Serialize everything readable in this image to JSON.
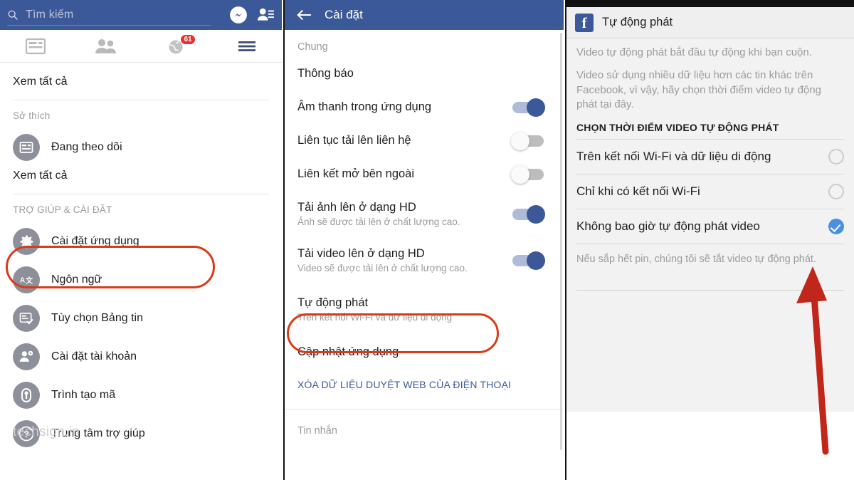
{
  "left_panel": {
    "search": {
      "placeholder": "Tìm kiếm",
      "icon": "search-icon"
    },
    "topbar_icons": [
      {
        "name": "messenger-icon"
      },
      {
        "name": "friend-requests-icon"
      }
    ],
    "tabs": [
      {
        "name": "news-feed-icon",
        "badge": ""
      },
      {
        "name": "friends-icon",
        "badge": ""
      },
      {
        "name": "notifications-globe-icon",
        "badge": "61"
      },
      {
        "name": "menu-hamburger-icon",
        "badge": ""
      }
    ],
    "see_all_top": "Xem tất cả",
    "section_interests": "Sở thích",
    "following_item": {
      "label": "Đang theo dõi",
      "icon": "feed-icon"
    },
    "see_all_bottom": "Xem tất cả",
    "section_help": "TRỢ GIÚP & CÀI ĐẶT",
    "items": [
      {
        "label": "Cài đặt ứng dụng",
        "icon": "gear-icon",
        "highlighted": true
      },
      {
        "label": "Ngôn ngữ",
        "icon": "translate-icon",
        "highlighted": false
      },
      {
        "label": "Tùy chọn Bảng tin",
        "icon": "feed-preferences-icon",
        "highlighted": false
      },
      {
        "label": "Cài đặt tài khoản",
        "icon": "account-settings-icon",
        "highlighted": false
      },
      {
        "label": "Trình tạo mã",
        "icon": "lock-icon",
        "highlighted": false
      },
      {
        "label": "Trung tâm trợ giúp",
        "icon": "question-mark-icon",
        "highlighted": false
      }
    ],
    "watermark": "techsign.in"
  },
  "mid_panel": {
    "back_icon": "back-arrow-icon",
    "title": "Cài đặt",
    "section_general": "Chung",
    "rows": [
      {
        "label": "Thông báo",
        "sub": "",
        "toggle": null
      },
      {
        "label": "Âm thanh trong ứng dụng",
        "sub": "",
        "toggle": "on"
      },
      {
        "label": "Liên tục tải lên liên hệ",
        "sub": "",
        "toggle": "off"
      },
      {
        "label": "Liên kết mở bên ngoài",
        "sub": "",
        "toggle": "off"
      },
      {
        "label": "Tải ảnh lên ở dạng HD",
        "sub": "Ảnh sẽ được tải lên ở chất lượng cao.",
        "toggle": "on"
      },
      {
        "label": "Tải video lên ở dạng HD",
        "sub": "Video sẽ được tải lên ở chất lượng cao.",
        "toggle": "on"
      },
      {
        "label": "Tự động phát",
        "sub": "Trên kết nối Wi-Fi và dữ liệu di động",
        "toggle": null,
        "highlighted": true
      },
      {
        "label": "Cập nhật ứng dụng",
        "sub": "",
        "toggle": null
      }
    ],
    "clear_link": "XÓA DỮ LIỆU DUYỆT WEB CỦA ĐIỆN THOẠI",
    "section_messages": "Tin nhắn"
  },
  "right_panel": {
    "logo": "f",
    "title": "Tự động phát",
    "paragraph_1": "Video tự động phát bắt đầu tự động khi bạn cuộn.",
    "paragraph_2": "Video sử dụng nhiều dữ liệu hơn các tin khác trên Facebook, vì vậy, hãy chọn thời điểm video tự động phát tại đây.",
    "section_heading": "CHỌN THỜI ĐIỂM VIDEO TỰ ĐỘNG PHÁT",
    "options": [
      {
        "label": "Trên kết nối Wi-Fi và dữ liệu di động",
        "selected": false
      },
      {
        "label": "Chỉ khi có kết nối Wi-Fi",
        "selected": false
      },
      {
        "label": "Không bao giờ tự động phát video",
        "selected": true
      }
    ],
    "note": "Nếu sắp hết pin, chúng tôi sẽ tắt video tự động phát.",
    "annotation_arrow": "red-arrow-pointing-to-selected-option"
  },
  "colors": {
    "facebook_blue": "#3b5998",
    "highlight_red": "#d93a17",
    "arrow_red": "#c1261a",
    "checked_blue": "#4a90e2",
    "muted_text": "#9b9b9b",
    "badge_red": "#e63232"
  }
}
